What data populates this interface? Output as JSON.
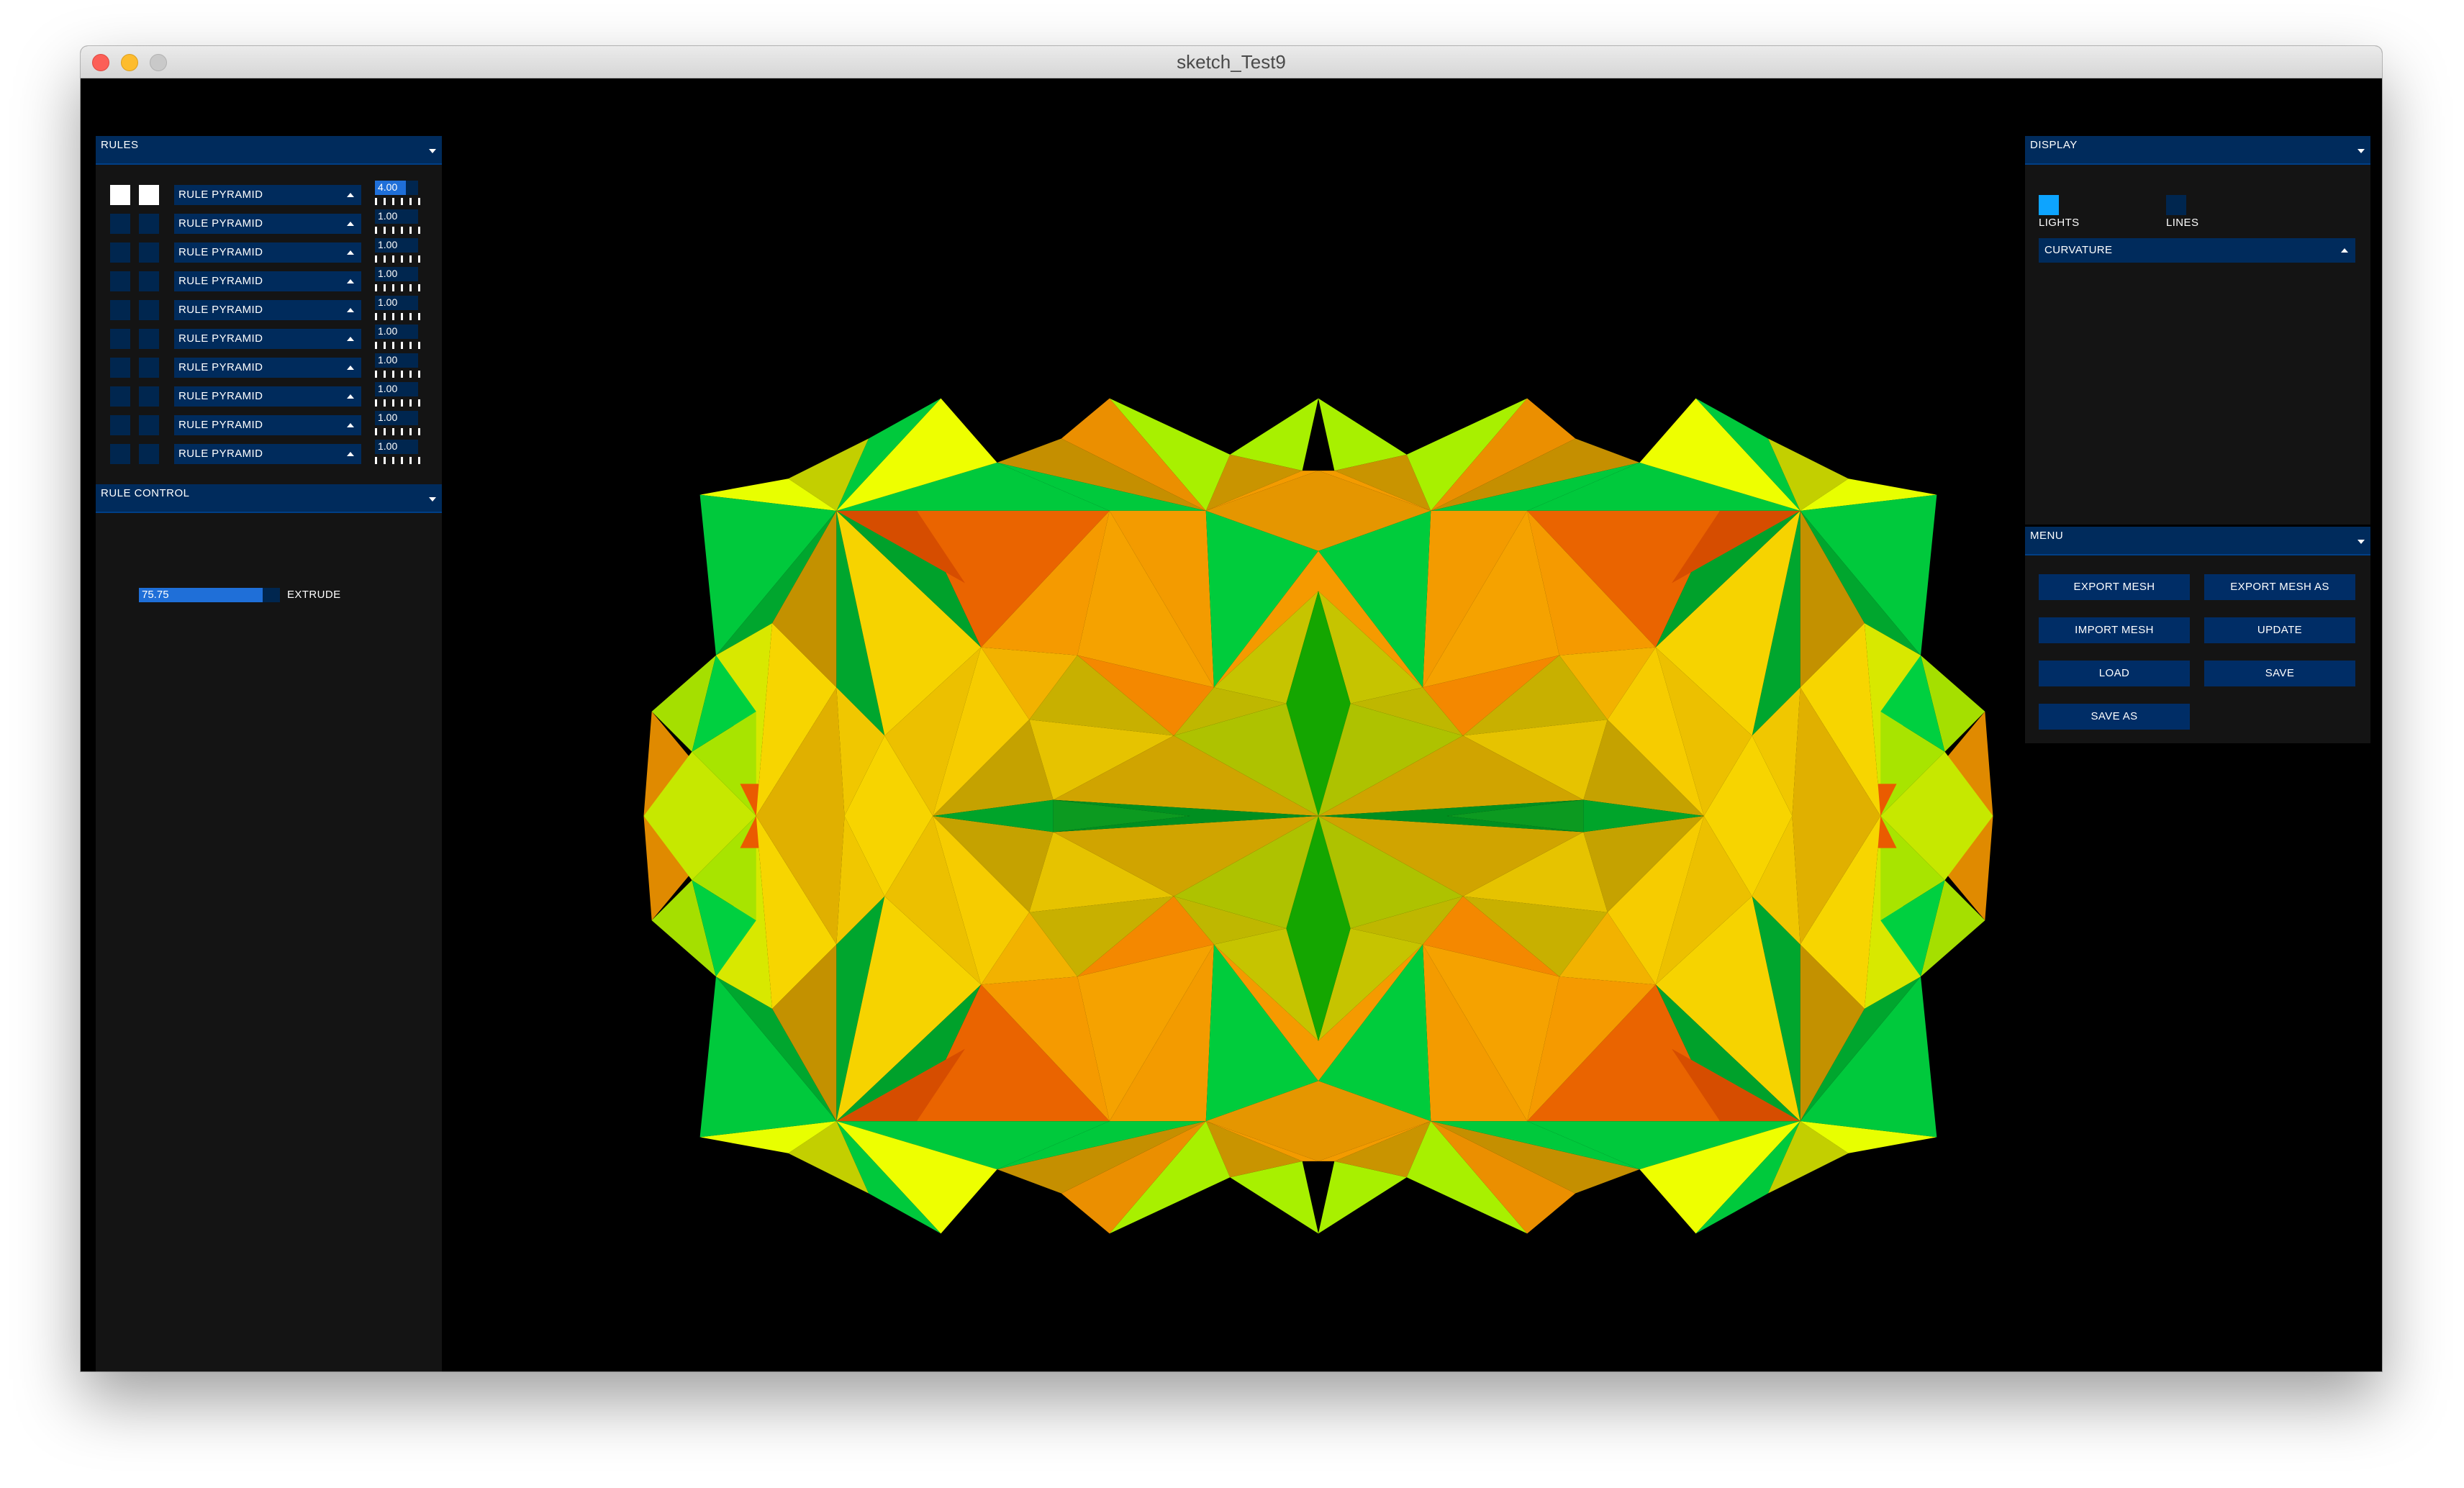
{
  "window": {
    "title": "sketch_Test9"
  },
  "rules_panel": {
    "header": "RULES",
    "rows": [
      {
        "rule": "RULE PYRAMID",
        "value": "4.00",
        "fraction": 0.72,
        "checked_a": true,
        "checked_b": true
      },
      {
        "rule": "RULE PYRAMID",
        "value": "1.00",
        "fraction": 0.0,
        "checked_a": false,
        "checked_b": false
      },
      {
        "rule": "RULE PYRAMID",
        "value": "1.00",
        "fraction": 0.0,
        "checked_a": false,
        "checked_b": false
      },
      {
        "rule": "RULE PYRAMID",
        "value": "1.00",
        "fraction": 0.0,
        "checked_a": false,
        "checked_b": false
      },
      {
        "rule": "RULE PYRAMID",
        "value": "1.00",
        "fraction": 0.0,
        "checked_a": false,
        "checked_b": false
      },
      {
        "rule": "RULE PYRAMID",
        "value": "1.00",
        "fraction": 0.0,
        "checked_a": false,
        "checked_b": false
      },
      {
        "rule": "RULE PYRAMID",
        "value": "1.00",
        "fraction": 0.0,
        "checked_a": false,
        "checked_b": false
      },
      {
        "rule": "RULE PYRAMID",
        "value": "1.00",
        "fraction": 0.0,
        "checked_a": false,
        "checked_b": false
      },
      {
        "rule": "RULE PYRAMID",
        "value": "1.00",
        "fraction": 0.0,
        "checked_a": false,
        "checked_b": false
      },
      {
        "rule": "RULE PYRAMID",
        "value": "1.00",
        "fraction": 0.0,
        "checked_a": false,
        "checked_b": false
      }
    ]
  },
  "rule_control": {
    "header": "RULE CONTROL",
    "extrude": {
      "label": "EXTRUDE",
      "value": "75.75",
      "fraction": 0.88
    }
  },
  "display_panel": {
    "header": "DISPLAY",
    "lights": {
      "label": "LIGHTS",
      "on": true
    },
    "lines": {
      "label": "LINES",
      "on": false
    },
    "mode": "CURVATURE"
  },
  "menu_panel": {
    "header": "MENU",
    "buttons": {
      "export_mesh": "EXPORT MESH",
      "export_mesh_as": "EXPORT MESH AS",
      "import_mesh": "IMPORT MESH",
      "update": "UPDATE",
      "load": "LOAD",
      "save": "SAVE",
      "save_as": "SAVE AS"
    }
  },
  "colors": {
    "panel_header": "#002b5c",
    "accent": "#1f6fd8",
    "toggle_on": "#0da4ff",
    "background": "#000000",
    "mesh_red": "#ea6100",
    "mesh_orange": "#f39b00",
    "mesh_yellow": "#f6d300",
    "mesh_lime": "#a8f000",
    "mesh_green": "#00c93c"
  }
}
